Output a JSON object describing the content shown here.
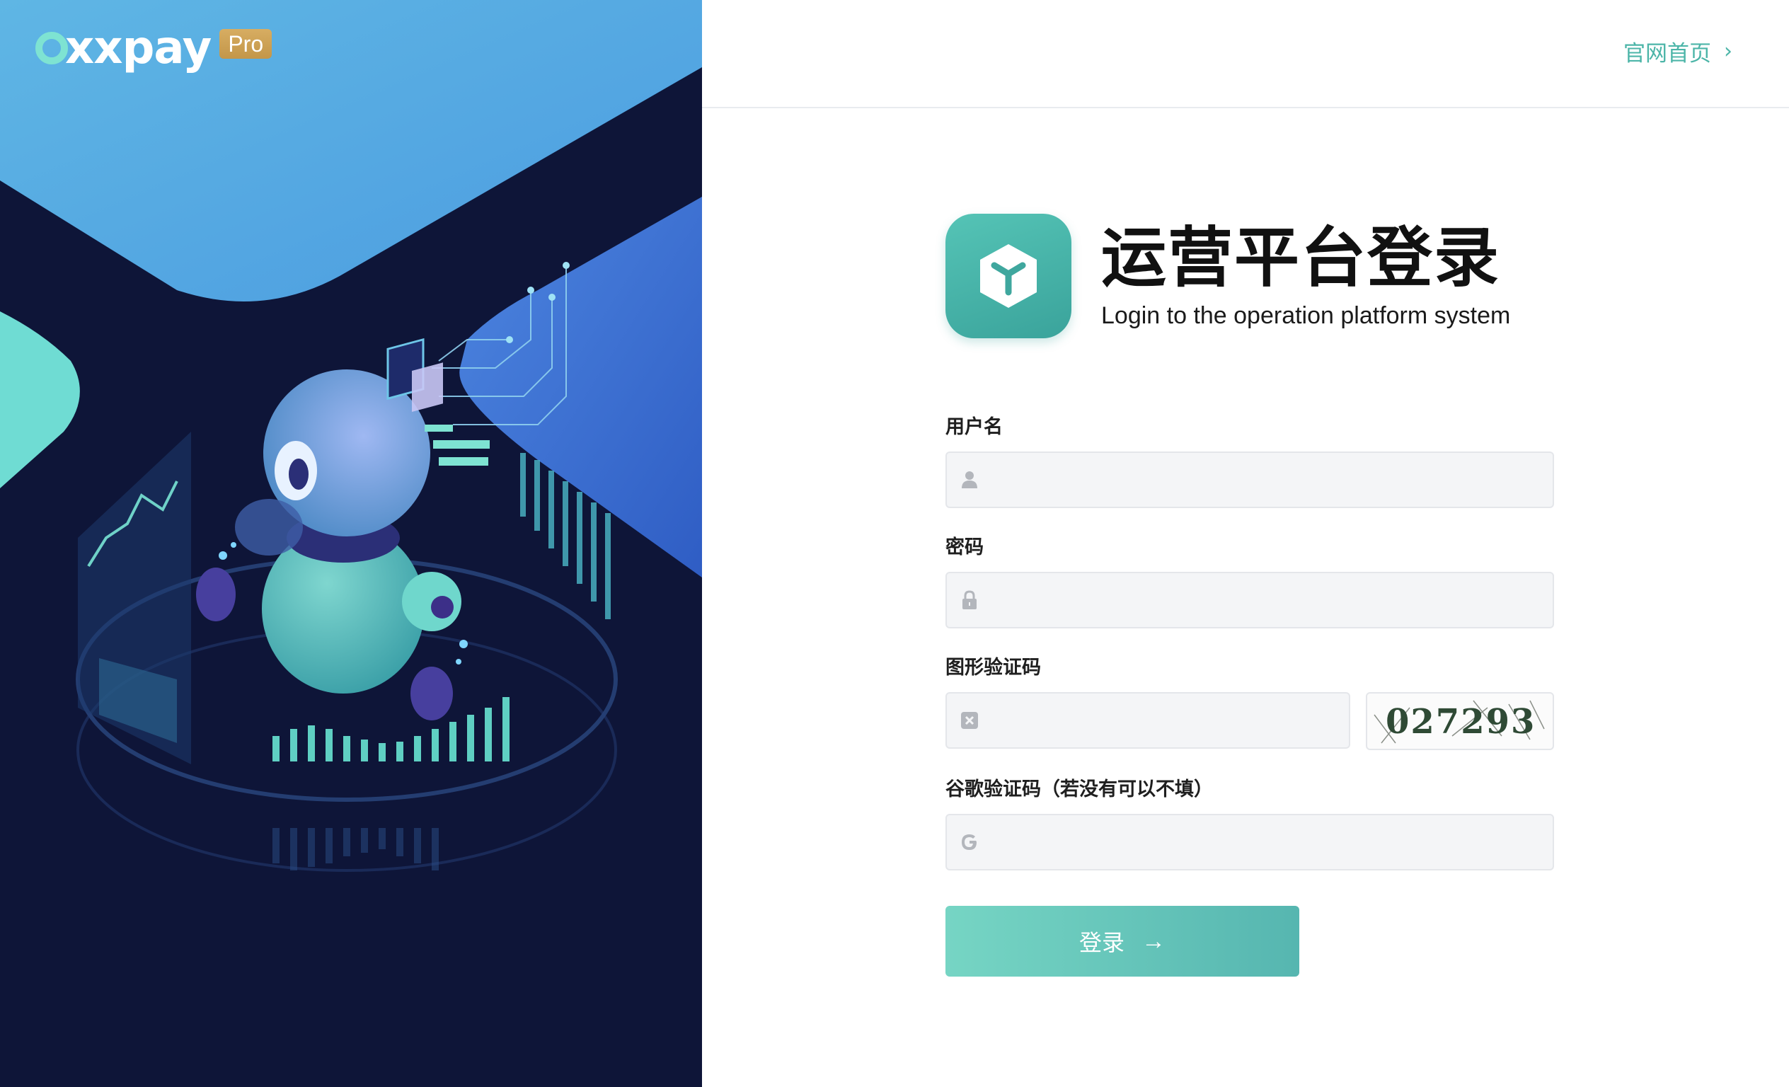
{
  "brand": {
    "name": "xxpay",
    "badge": "Pro"
  },
  "topbar": {
    "home_link": "官网首页",
    "home_chevron": "›"
  },
  "title": {
    "zh": "运营平台登录",
    "en": "Login to the operation platform system"
  },
  "form": {
    "username": {
      "label": "用户名",
      "value": "",
      "icon": "user-icon"
    },
    "password": {
      "label": "密码",
      "value": "",
      "icon": "lock-icon"
    },
    "captcha": {
      "label": "图形验证码",
      "value": "",
      "icon": "shield-icon",
      "image_code": "027293"
    },
    "google_code": {
      "label": "谷歌验证码（若没有可以不填）",
      "value": "",
      "icon": "google-icon"
    }
  },
  "login_button": {
    "label": "登录",
    "arrow": "→"
  },
  "colors": {
    "accent": "#4cb5a8",
    "left_bg": "#0e1538",
    "button_start": "#76d5c4",
    "button_end": "#56b6b0",
    "badge": "#c9a050"
  }
}
